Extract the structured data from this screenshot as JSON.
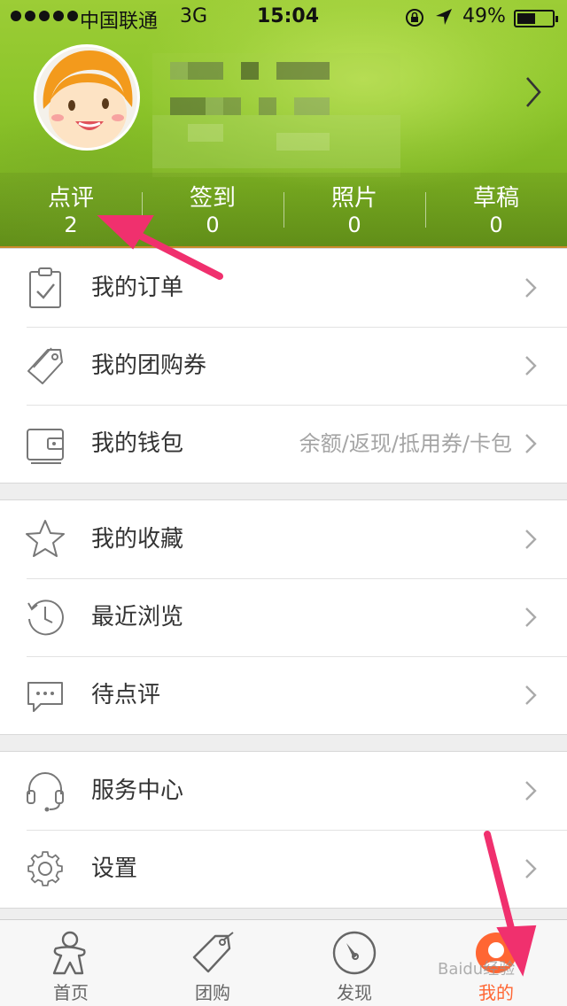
{
  "status_bar": {
    "carrier": "中国联通",
    "network": "3G",
    "time": "15:04",
    "battery": "49%"
  },
  "profile": {
    "stats": [
      {
        "label": "点评",
        "value": "2"
      },
      {
        "label": "签到",
        "value": "0"
      },
      {
        "label": "照片",
        "value": "0"
      },
      {
        "label": "草稿",
        "value": "0"
      }
    ]
  },
  "menu": {
    "group1": [
      {
        "label": "我的订单",
        "icon": "clipboard-check-icon"
      },
      {
        "label": "我的团购券",
        "icon": "tag-icon"
      },
      {
        "label": "我的钱包",
        "icon": "wallet-icon",
        "hint": "余额/返现/抵用券/卡包"
      }
    ],
    "group2": [
      {
        "label": "我的收藏",
        "icon": "star-icon"
      },
      {
        "label": "最近浏览",
        "icon": "history-clock-icon"
      },
      {
        "label": "待点评",
        "icon": "chat-bubble-icon"
      }
    ],
    "group3": [
      {
        "label": "服务中心",
        "icon": "headset-icon"
      },
      {
        "label": "设置",
        "icon": "gear-icon"
      }
    ]
  },
  "tabbar": [
    {
      "label": "首页",
      "icon": "home-person-icon",
      "active": false
    },
    {
      "label": "团购",
      "icon": "tag-icon",
      "active": false
    },
    {
      "label": "发现",
      "icon": "compass-icon",
      "active": false
    },
    {
      "label": "我的",
      "icon": "my-profile-icon",
      "active": true
    }
  ],
  "colors": {
    "header_green": "#8cc52a",
    "accent_orange": "#ff6633",
    "annotation_arrow": "#f0306e"
  }
}
